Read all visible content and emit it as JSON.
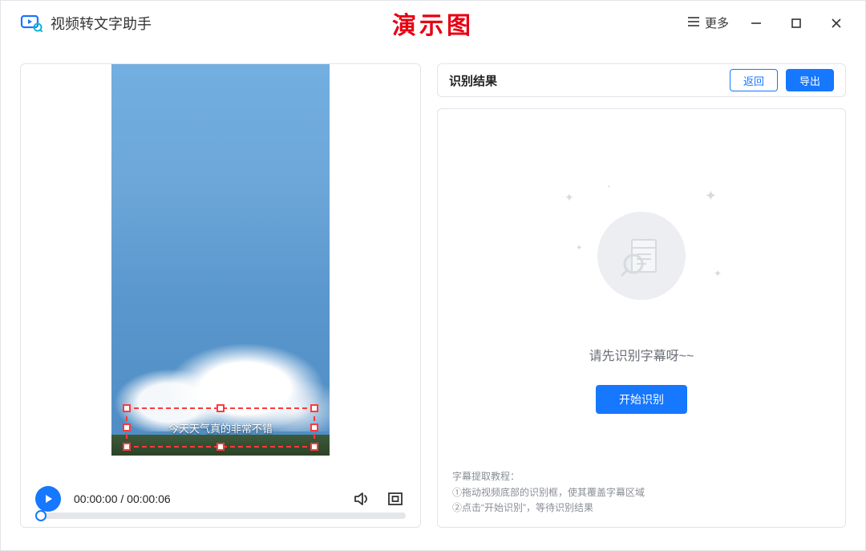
{
  "titlebar": {
    "app_title": "视频转文字助手",
    "demo_label": "演示图",
    "more_label": "更多"
  },
  "player": {
    "subtitle_text": "今天天气真的非常不错",
    "current_time": "00:00:00",
    "duration": "00:00:06"
  },
  "result": {
    "title": "识别结果",
    "back_label": "返回",
    "export_label": "导出",
    "placeholder_text": "请先识别字幕呀~~",
    "start_label": "开始识别"
  },
  "tutorial": {
    "heading": "字幕提取教程：",
    "step1": "①拖动视频底部的识别框，使其覆盖字幕区域",
    "step2": "②点击“开始识别”，等待识别结果"
  }
}
